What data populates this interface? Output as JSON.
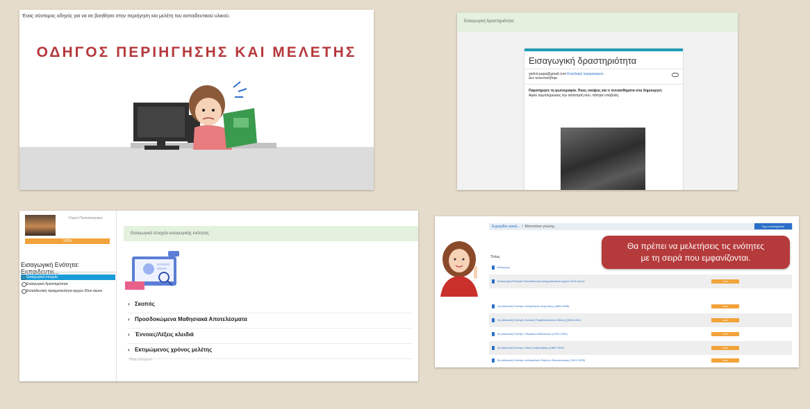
{
  "panel1": {
    "subtitle": "Ένας σύντομος οδηγός για να σε βοηθήσει στην περιήγηση και μελέτη του εκπαιδευτικού υλικού.",
    "title": "ΟΔΗΓΟΣ ΠΕΡΙΗΓΗΣΗΣ ΚΑΙ ΜΕΛΕΤΗΣ"
  },
  "panel2": {
    "header": "Εισαγωγική δραστηριότητα",
    "card_title": "Εισαγωγική δραστηριότητα",
    "email": "ypdrol.papa@gmail.com",
    "switch_account": "Εναλλαγή λογαριασμού",
    "not_shared": "Δεν κοινοποιήθηκε",
    "question": "Παρατήρησε τη φωτογραφία. Ποιες σκέψεις και τι συναισθήματα σου δημιουργεί;",
    "instruction": "Αφού συμπληρώσεις την απάντησή σου, πάτησε υποβολή."
  },
  "panel3": {
    "course_name": "Υλικού Πιστοποιητικού",
    "progress": "100%",
    "unit_title": "Εισαγωγική Ενότητα: Εκπαιδευτικ...",
    "nav": [
      "Εισαγωγικά στοιχεία",
      "Εισαγωγική δραστηριότητα",
      "Εκπαιδευτική πραγματικότητα αρχών 20ού αιώνα"
    ],
    "header": "Εισαγωγικά στοιχεία εισαγωγικής ενότητας",
    "sections": [
      "Σκοπός",
      "Προσδοκώμενα Μαθησιακά Αποτελέσματα",
      "Έννοιες/Λέξεις κλειδιά",
      "Εκτιμώμενος χρόνος μελέτης"
    ],
    "footer": "Πίσω    Επόμενο"
  },
  "panel4": {
    "breadcrumb_home": "Εγχειρίδιο εγκαλ...",
    "breadcrumb_current": "Μονοπάτια γνώσης",
    "button": "Έχω ολοκληρώσει",
    "column_header": "Τίτλος",
    "rows": [
      {
        "title": "Εισαγωγή",
        "pct": ""
      },
      {
        "title": "Εισαγωγική Ενότητα: Εκπαιδευτική πραγματικότητα αρχών 20ού αιώνα",
        "pct": "100%"
      },
      {
        "title": "1η Διδακτική Ενότητα: Αλέξανδρος Δελμούζος (1880-1956)",
        "pct": "100%"
      },
      {
        "title": "2η Διδακτική Ενότητα: Ανατολή Παρθενιουτσέων Βάλλη (1908-1911)",
        "pct": "100%"
      },
      {
        "title": "3η Διδακτική Ενότητα: Πειραϊκό Διδασκαλείο (1923-1926)",
        "pct": "100%"
      },
      {
        "title": "4η Διδακτική Ενότητα: Νίκος Καζαντζάκης (1883-1940)",
        "pct": "100%"
      },
      {
        "title": "5η Διδακτική Ενότητα: Διδασκαλείο Θηλέων Θεσσαλονίκης (1921-1930)",
        "pct": "100%"
      }
    ],
    "bubble_line1": "Θα πρέπει να μελετήσεις τις ενότητες",
    "bubble_line2": "με τη σειρά που εμφανίζονται."
  }
}
